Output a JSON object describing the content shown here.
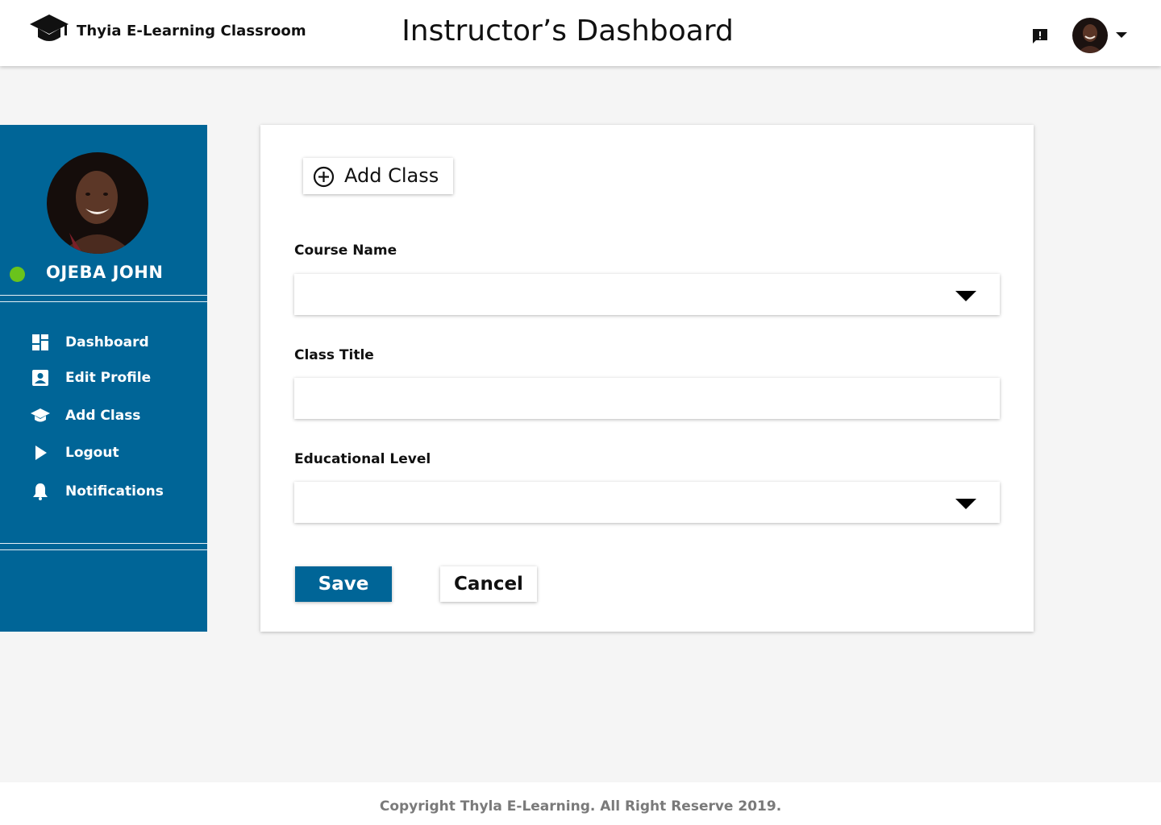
{
  "header": {
    "brand_name": "Thyia E-Learning Classroom",
    "title": "Instructor’s Dashboard",
    "icons": [
      "graduation-cap-icon",
      "message-alert-icon",
      "avatar",
      "chevron-down-icon"
    ]
  },
  "sidebar": {
    "user_name": "OJEBA JOHN",
    "status_color": "#6ac31c",
    "items": [
      {
        "label": "Dashboard",
        "icon": "dashboard-icon"
      },
      {
        "label": "Edit Profile",
        "icon": "profile-card-icon"
      },
      {
        "label": "Add Class",
        "icon": "graduation-cap-icon"
      },
      {
        "label": "Logout",
        "icon": "play-arrow-icon"
      },
      {
        "label": "Notifications",
        "icon": "bell-icon"
      }
    ]
  },
  "form": {
    "heading": "Add Class",
    "course_name_label": "Course Name",
    "course_name_value": "",
    "class_title_label": "Class Title",
    "class_title_value": "",
    "educational_level_label": "Educational Level",
    "educational_level_value": "",
    "save_label": "Save",
    "cancel_label": "Cancel"
  },
  "footer": {
    "copyright": "Copyright Thyla E-Learning. All Right Reserve 2019."
  },
  "colors": {
    "primary": "#006597",
    "background": "#f5f5f5",
    "online": "#6ac31c",
    "footer_text": "#7a7a7a"
  }
}
